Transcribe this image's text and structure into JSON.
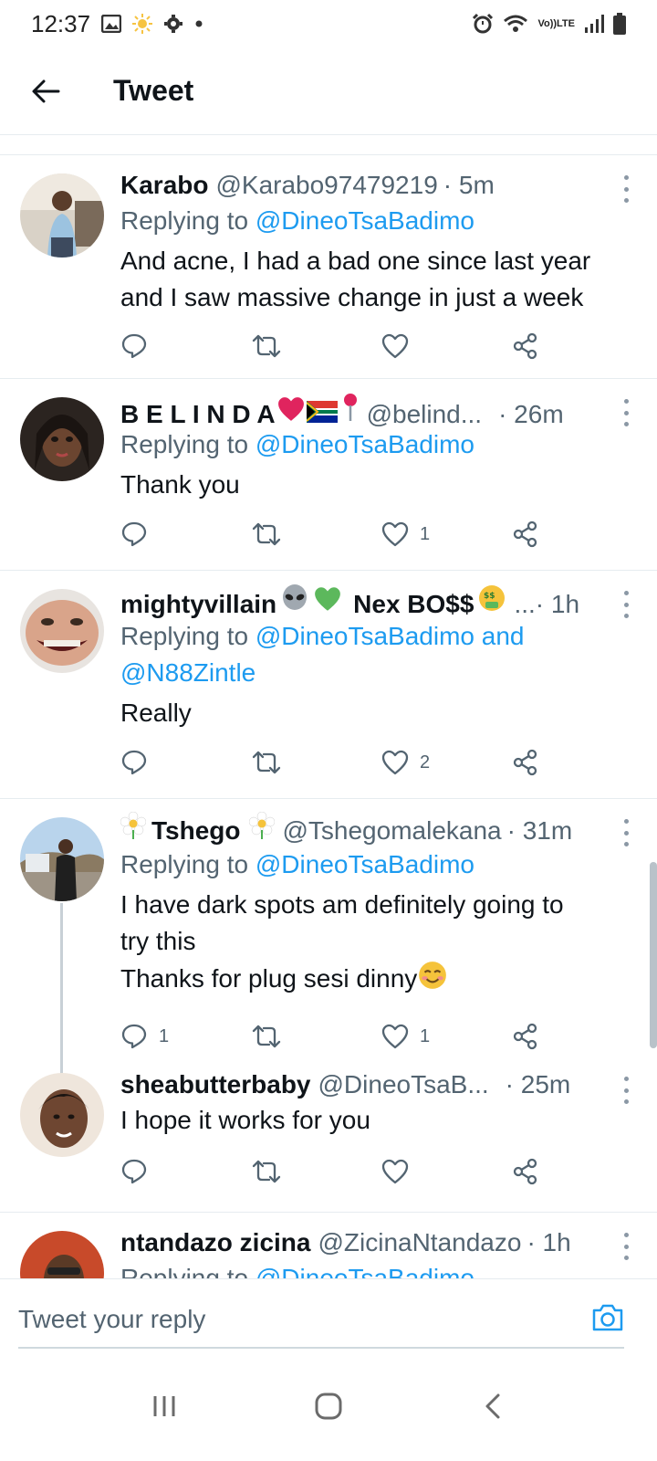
{
  "status_bar": {
    "time": "12:37",
    "left_icons": [
      "gallery-icon",
      "sun-icon",
      "settings-icon",
      "dot-icon"
    ],
    "right_icons": [
      "alarm-icon",
      "wifi-icon",
      "volte-icon",
      "signal-icon",
      "battery-icon"
    ],
    "volte_top": "Vo))",
    "volte_bottom": "LTE"
  },
  "header": {
    "title": "Tweet"
  },
  "tweets": [
    {
      "name": "Karabo",
      "handle": "@Karabo97479219",
      "time": "· 5m",
      "replying_prefix": "Replying to ",
      "replying_to": "@DineoTsaBadimo",
      "text_lines": [
        "And acne, I had a bad one since last year",
        "and I saw massive change in just a week"
      ],
      "reply_count": "",
      "retweet_count": "",
      "like_count": ""
    },
    {
      "name": "B E L I N D A",
      "handle": "@belind...",
      "time": "· 26m",
      "replying_prefix": "Replying to ",
      "replying_to": "@DineoTsaBadimo",
      "text_lines": [
        "Thank you"
      ],
      "reply_count": "",
      "retweet_count": "",
      "like_count": "1"
    },
    {
      "name": "mightyvillain",
      "name_suffix": "Nex BO$$",
      "handle": "...",
      "time": "· 1h",
      "replying_prefix": "Replying to ",
      "replying_to": "@DineoTsaBadimo and",
      "replying_to_2": "@N88Zintle",
      "text_lines": [
        "Really"
      ],
      "reply_count": "",
      "retweet_count": "",
      "like_count": "2"
    },
    {
      "name": "Tshego",
      "handle": "@Tshegomalekana",
      "time": "· 31m",
      "replying_prefix": "Replying to ",
      "replying_to": "@DineoTsaBadimo",
      "text_lines": [
        "I have dark spots am definitely going to",
        "try this",
        "Thanks for plug sesi dinny"
      ],
      "reply_count": "1",
      "retweet_count": "",
      "like_count": "1"
    },
    {
      "name": "sheabutterbaby",
      "handle": "@DineoTsaB...",
      "time": "· 25m",
      "text_lines": [
        "I hope it works for you"
      ],
      "reply_count": "",
      "retweet_count": "",
      "like_count": ""
    },
    {
      "name": "ntandazo zicina",
      "handle": "@ZicinaNtandazo",
      "time": "· 1h",
      "replying_prefix": "Replying to ",
      "replying_to": "@DineoTsaBadimo",
      "text_lines": []
    }
  ],
  "reply_bar": {
    "placeholder": "Tweet your reply"
  },
  "colors": {
    "link": "#1d9bf0",
    "secondary": "#536471",
    "primary": "#0f1419",
    "divider": "#e6ecf0"
  }
}
